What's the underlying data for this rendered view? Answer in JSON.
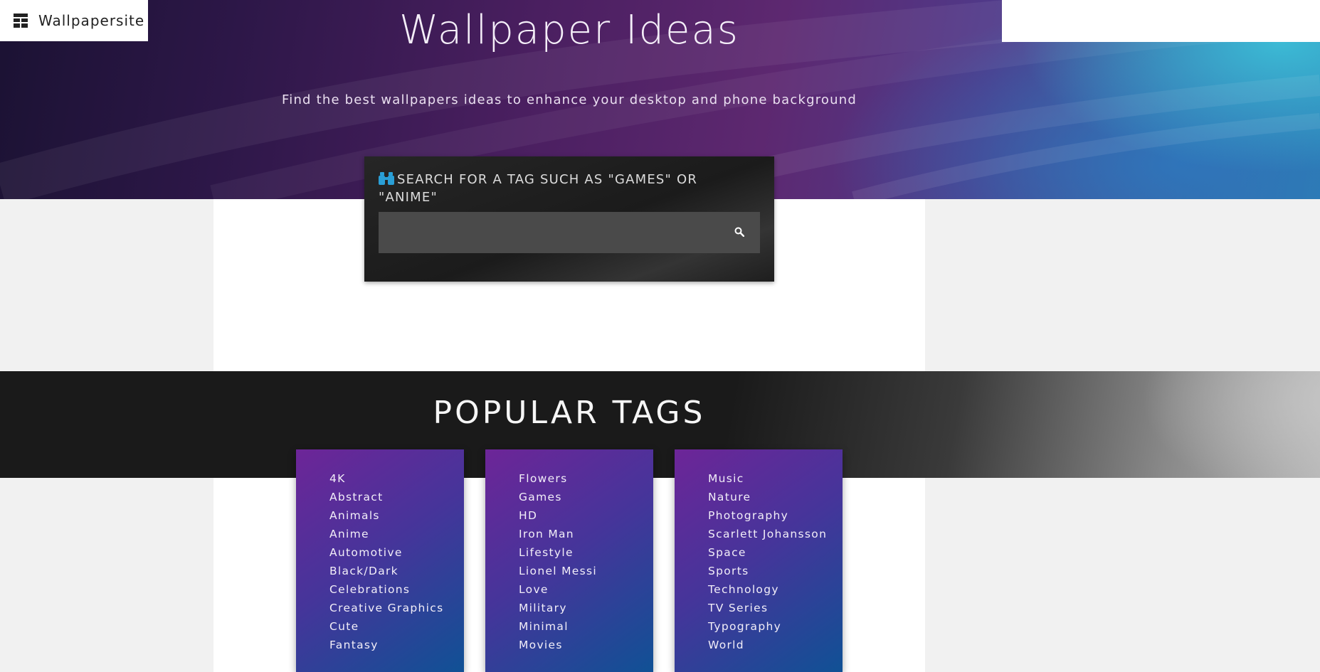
{
  "brand": {
    "name": "Wallpapersite",
    "icon": "grid-logo-icon"
  },
  "hero": {
    "title": "Wallpaper Ideas",
    "subtitle": "Find the best wallpapers ideas to enhance your desktop and phone background"
  },
  "search": {
    "label": "SEARCH FOR A TAG SUCH AS \"GAMES\" OR \"ANIME\"",
    "label_icon": "binoculars-icon",
    "value": "",
    "placeholder": "",
    "button_icon": "search-icon"
  },
  "popular": {
    "title": "POPULAR TAGS",
    "columns": [
      [
        "4K",
        "Abstract",
        "Animals",
        "Anime",
        "Automotive",
        "Black/Dark",
        "Celebrations",
        "Creative Graphics",
        "Cute",
        "Fantasy"
      ],
      [
        "Flowers",
        "Games",
        "HD",
        "Iron Man",
        "Lifestyle",
        "Lionel Messi",
        "Love",
        "Military",
        "Minimal",
        "Movies"
      ],
      [
        "Music",
        "Nature",
        "Photography",
        "Scarlett Johansson",
        "Space",
        "Sports",
        "Technology",
        "TV Series",
        "Typography",
        "World"
      ]
    ]
  },
  "colors": {
    "accent_icon": "#2a9fd6",
    "tag_card_start": "#6d2598",
    "tag_card_end": "#105195"
  }
}
